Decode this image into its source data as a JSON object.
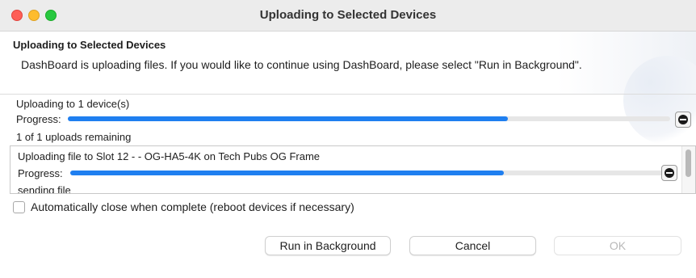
{
  "window": {
    "title": "Uploading to Selected Devices"
  },
  "header": {
    "title": "Uploading to Selected Devices",
    "description": "DashBoard is uploading files.  If you would like to continue using DashBoard, please select \"Run in Background\"."
  },
  "overall": {
    "devices_label": "Uploading to 1 device(s)",
    "progress_label": "Progress:",
    "progress": 0.73,
    "remaining": "1 of 1 uploads remaining"
  },
  "file_upload": {
    "label": "Uploading file to Slot 12 -  - OG-HA5-4K on Tech Pubs OG Frame",
    "progress_label": "Progress:",
    "progress": 0.73,
    "status": "sending file"
  },
  "auto_close": {
    "label": "Automatically close when complete (reboot devices if necessary)",
    "checked": false
  },
  "buttons": {
    "run_in_background": "Run in Background",
    "cancel": "Cancel",
    "ok": "OK"
  },
  "colors": {
    "progress_fill": "#1f7ff0",
    "progress_track": "#e6e6e6"
  }
}
